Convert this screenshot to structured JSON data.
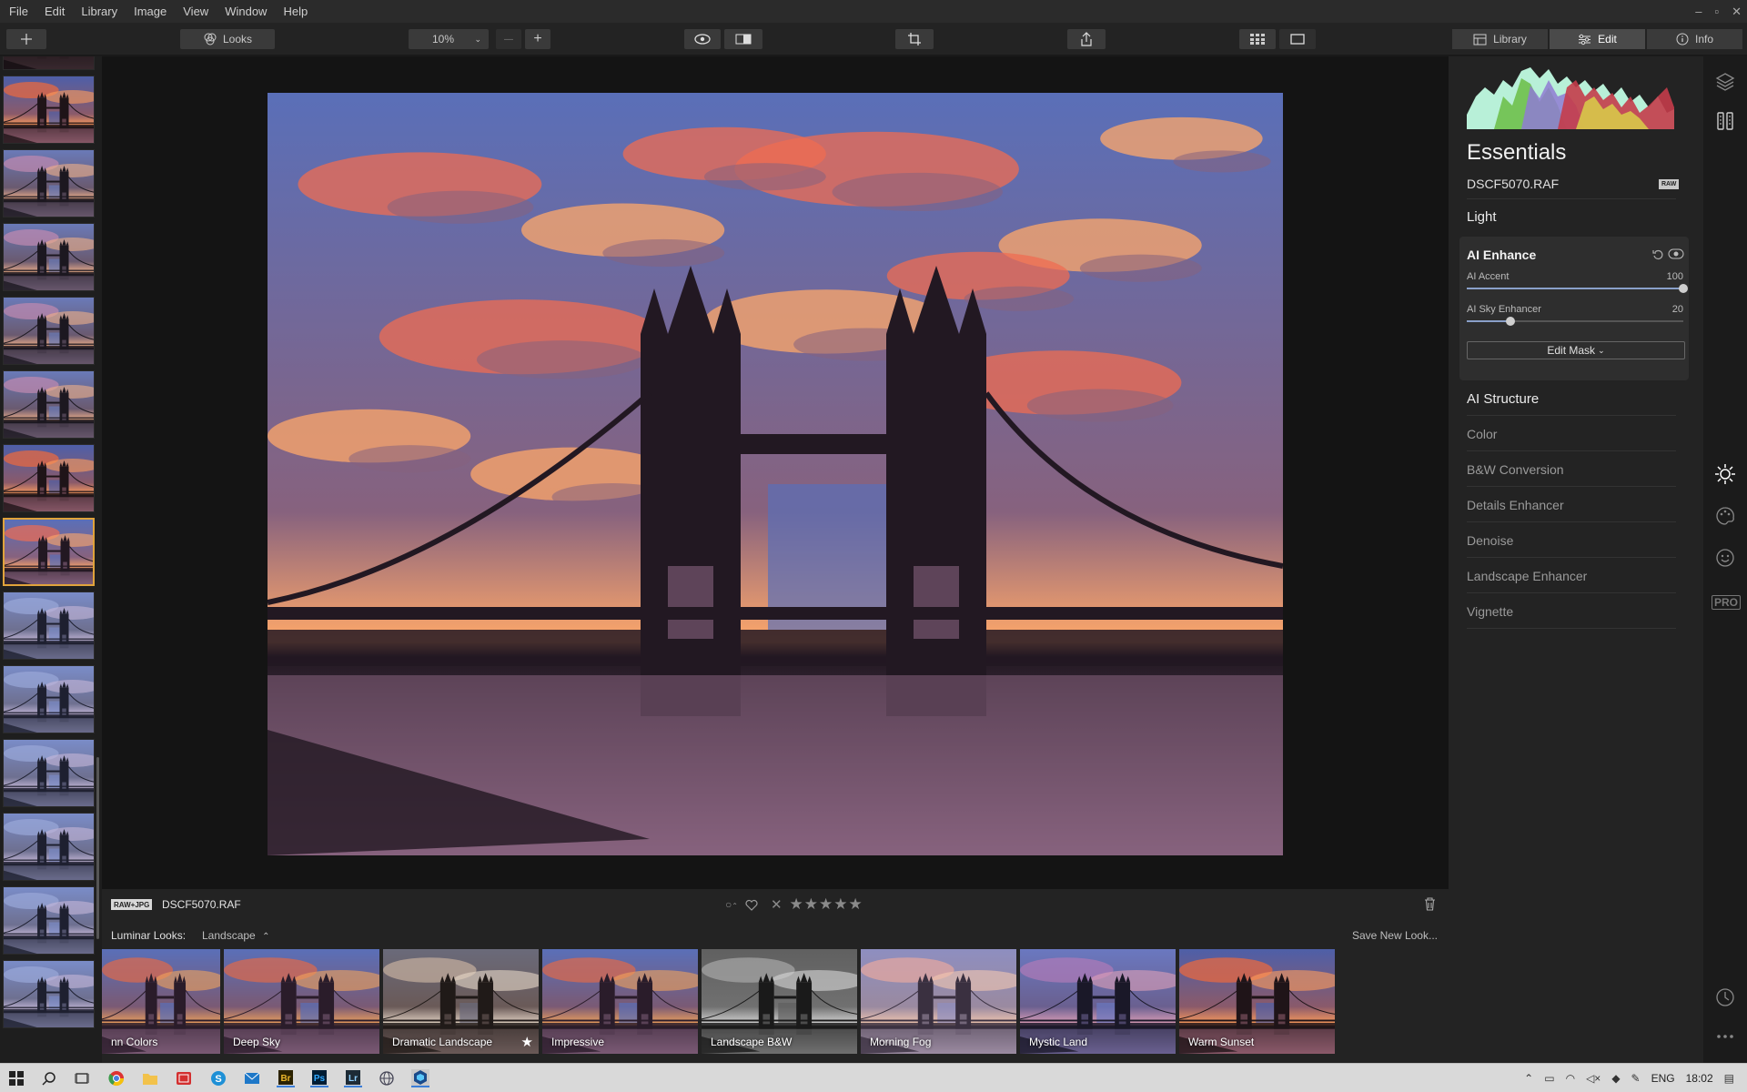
{
  "menu": [
    "File",
    "Edit",
    "Library",
    "Image",
    "View",
    "Window",
    "Help"
  ],
  "window_controls": [
    "–",
    "▫",
    "✕"
  ],
  "toolbar": {
    "looks_label": "Looks",
    "zoom_value": "10%",
    "zoom_out": "—",
    "zoom_in": "+"
  },
  "mode_tabs": [
    {
      "label": "Library",
      "icon": "library-icon",
      "active": false
    },
    {
      "label": "Edit",
      "icon": "sliders-icon",
      "active": true
    },
    {
      "label": "Info",
      "icon": "info-icon",
      "active": false
    }
  ],
  "panel": {
    "title": "Essentials",
    "filename": "DSCF5070.RAF",
    "raw_badge": "RAW",
    "section_light": "Light",
    "ai_enhance": {
      "title": "AI Enhance",
      "sliders": [
        {
          "label": "AI Accent",
          "value": "100",
          "fraction": 1.0
        },
        {
          "label": "AI Sky Enhancer",
          "value": "20",
          "fraction": 0.2
        }
      ],
      "edit_mask": "Edit Mask",
      "edit_mask_arrow": "⌄"
    },
    "tools": [
      {
        "label": "AI Structure",
        "strong": true
      },
      {
        "label": "Color",
        "strong": false
      },
      {
        "label": "B&W Conversion",
        "strong": false
      },
      {
        "label": "Details Enhancer",
        "strong": false
      },
      {
        "label": "Denoise",
        "strong": false
      },
      {
        "label": "Landscape Enhancer",
        "strong": false
      },
      {
        "label": "Vignette",
        "strong": false
      }
    ]
  },
  "infobar": {
    "badge": "RAW+JPG",
    "filename": "DSCF5070.RAF",
    "stars": "★★★★★",
    "reject": "✕"
  },
  "looks": {
    "label": "Luminar Looks:",
    "category": "Landscape",
    "category_arrow": "⌃",
    "save": "Save New Look...",
    "items": [
      {
        "label": "nn Colors",
        "tone": "warm"
      },
      {
        "label": "Deep Sky",
        "tone": "warm"
      },
      {
        "label": "Dramatic Landscape",
        "tone": "dramatic",
        "favorite": true
      },
      {
        "label": "Impressive",
        "tone": "warm"
      },
      {
        "label": "Landscape B&W",
        "tone": "bw"
      },
      {
        "label": "Morning Fog",
        "tone": "fog"
      },
      {
        "label": "Mystic Land",
        "tone": "cool"
      },
      {
        "label": "Warm Sunset",
        "tone": "sunset"
      }
    ]
  },
  "filmstrip": {
    "thumb_tones": [
      "dark",
      "sunset",
      "dusk",
      "dusk",
      "dusk",
      "dusk",
      "sunset",
      "selected",
      "blue",
      "blue",
      "blue",
      "blue",
      "blue",
      "blue"
    ],
    "selected_index": 7
  },
  "taskbar": {
    "tray_lang": "ENG",
    "tray_time": "18:02"
  },
  "colors": {
    "accent_selected": "#e0a33b",
    "slider_fill": "#8aa0c9"
  }
}
